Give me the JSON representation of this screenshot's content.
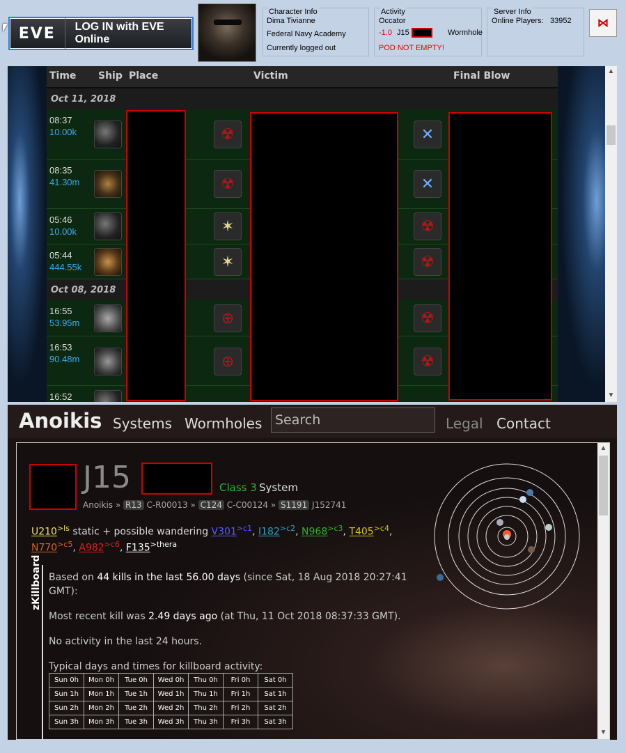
{
  "login": {
    "logo": "EVE",
    "label": "LOG IN with EVE Online"
  },
  "character": {
    "caption": "Character Info",
    "name": "Dima Tivianne",
    "corp": "Federal Navy Academy",
    "status": "Currently logged out"
  },
  "activity": {
    "caption": "Activity",
    "ship": "Occator",
    "sec": "-1.0",
    "system": "J15",
    "type": "Wormhole",
    "warning": "POD NOT EMPTY!"
  },
  "server": {
    "caption": "Server Info",
    "label": "Online Players:",
    "count": "33952"
  },
  "close_glyph": "⋈",
  "killboard": {
    "headers": [
      "Time",
      "Ship",
      "Place",
      "Victim",
      "Final Blow"
    ],
    "dates": [
      "Oct 11, 2018",
      "Oct 08, 2018"
    ],
    "kills": [
      {
        "time": "08:37",
        "value": "10.00k"
      },
      {
        "time": "08:35",
        "value": "41.30m"
      },
      {
        "time": "05:46",
        "value": "10.00k"
      },
      {
        "time": "05:44",
        "value": "444.55k"
      },
      {
        "time": "16:55",
        "value": "53.95m"
      },
      {
        "time": "16:53",
        "value": "90.48m"
      },
      {
        "time": "16:52",
        "value": ""
      }
    ]
  },
  "anoikis": {
    "brand": "Anoikis",
    "nav": [
      "Systems",
      "Wormholes",
      "Legal",
      "Contact"
    ],
    "search_placeholder": "Search",
    "system": {
      "name": "J15",
      "class_label": "Class 3",
      "suffix": "System",
      "breadcrumb": {
        "root": "Anoikis",
        "r": "R13",
        "r_name": "C-R00013",
        "c": "C124",
        "c_name": "C-C00124",
        "s": "S1191",
        "s_name": "J152741"
      }
    },
    "statics": {
      "static": "U210",
      "static_dest": ">ls",
      "text": " static + possible wandering ",
      "wanderers": [
        {
          "code": "V301",
          "dest": ">c1",
          "color": "#5b5bff"
        },
        {
          "code": "I182",
          "dest": ">c2",
          "color": "#2aa7c7"
        },
        {
          "code": "N968",
          "dest": ">c3",
          "color": "#2db32d"
        },
        {
          "code": "T405",
          "dest": ">c4",
          "color": "#d4c21a"
        },
        {
          "code": "N770",
          "dest": ">c5",
          "color": "#d2691e"
        },
        {
          "code": "A982",
          "dest": ">c6",
          "color": "#e02020"
        },
        {
          "code": "F135",
          "dest": ">thera",
          "color": "#ffffff"
        }
      ]
    },
    "zkill": {
      "label": "zKillboard",
      "line1_pre": "Based on ",
      "line1_b1": "44 kills in the last 56.00 days",
      "line1_post": " (since Sat, 18 Aug 2018 20:27:41",
      "line1_cont": "GMT):",
      "line2_pre": "Most recent kill was ",
      "line2_b": "2.49 days ago",
      "line2_post": " (at Thu, 11 Oct 2018 08:37:33 GMT).",
      "line3": "No activity in the last 24 hours.",
      "line4": "Typical days and times for killboard activity:",
      "grid": [
        [
          "Sun 0h",
          "Mon 0h",
          "Tue 0h",
          "Wed 0h",
          "Thu 0h",
          "Fri 0h",
          "Sat 0h"
        ],
        [
          "Sun 1h",
          "Mon 1h",
          "Tue 1h",
          "Wed 1h",
          "Thu 1h",
          "Fri 1h",
          "Sat 1h"
        ],
        [
          "Sun 2h",
          "Mon 2h",
          "Tue 2h",
          "Wed 2h",
          "Thu 2h",
          "Fri 2h",
          "Sat 2h"
        ],
        [
          "Sun 3h",
          "Mon 3h",
          "Tue 3h",
          "Wed 3h",
          "Thu 3h",
          "Fri 3h",
          "Sat 3h"
        ]
      ]
    }
  },
  "colors": {
    "accent": "#2e7ed8",
    "kill_value": "#3aa8f0",
    "row_bg": "#0d2810",
    "warning": "#e00000"
  }
}
